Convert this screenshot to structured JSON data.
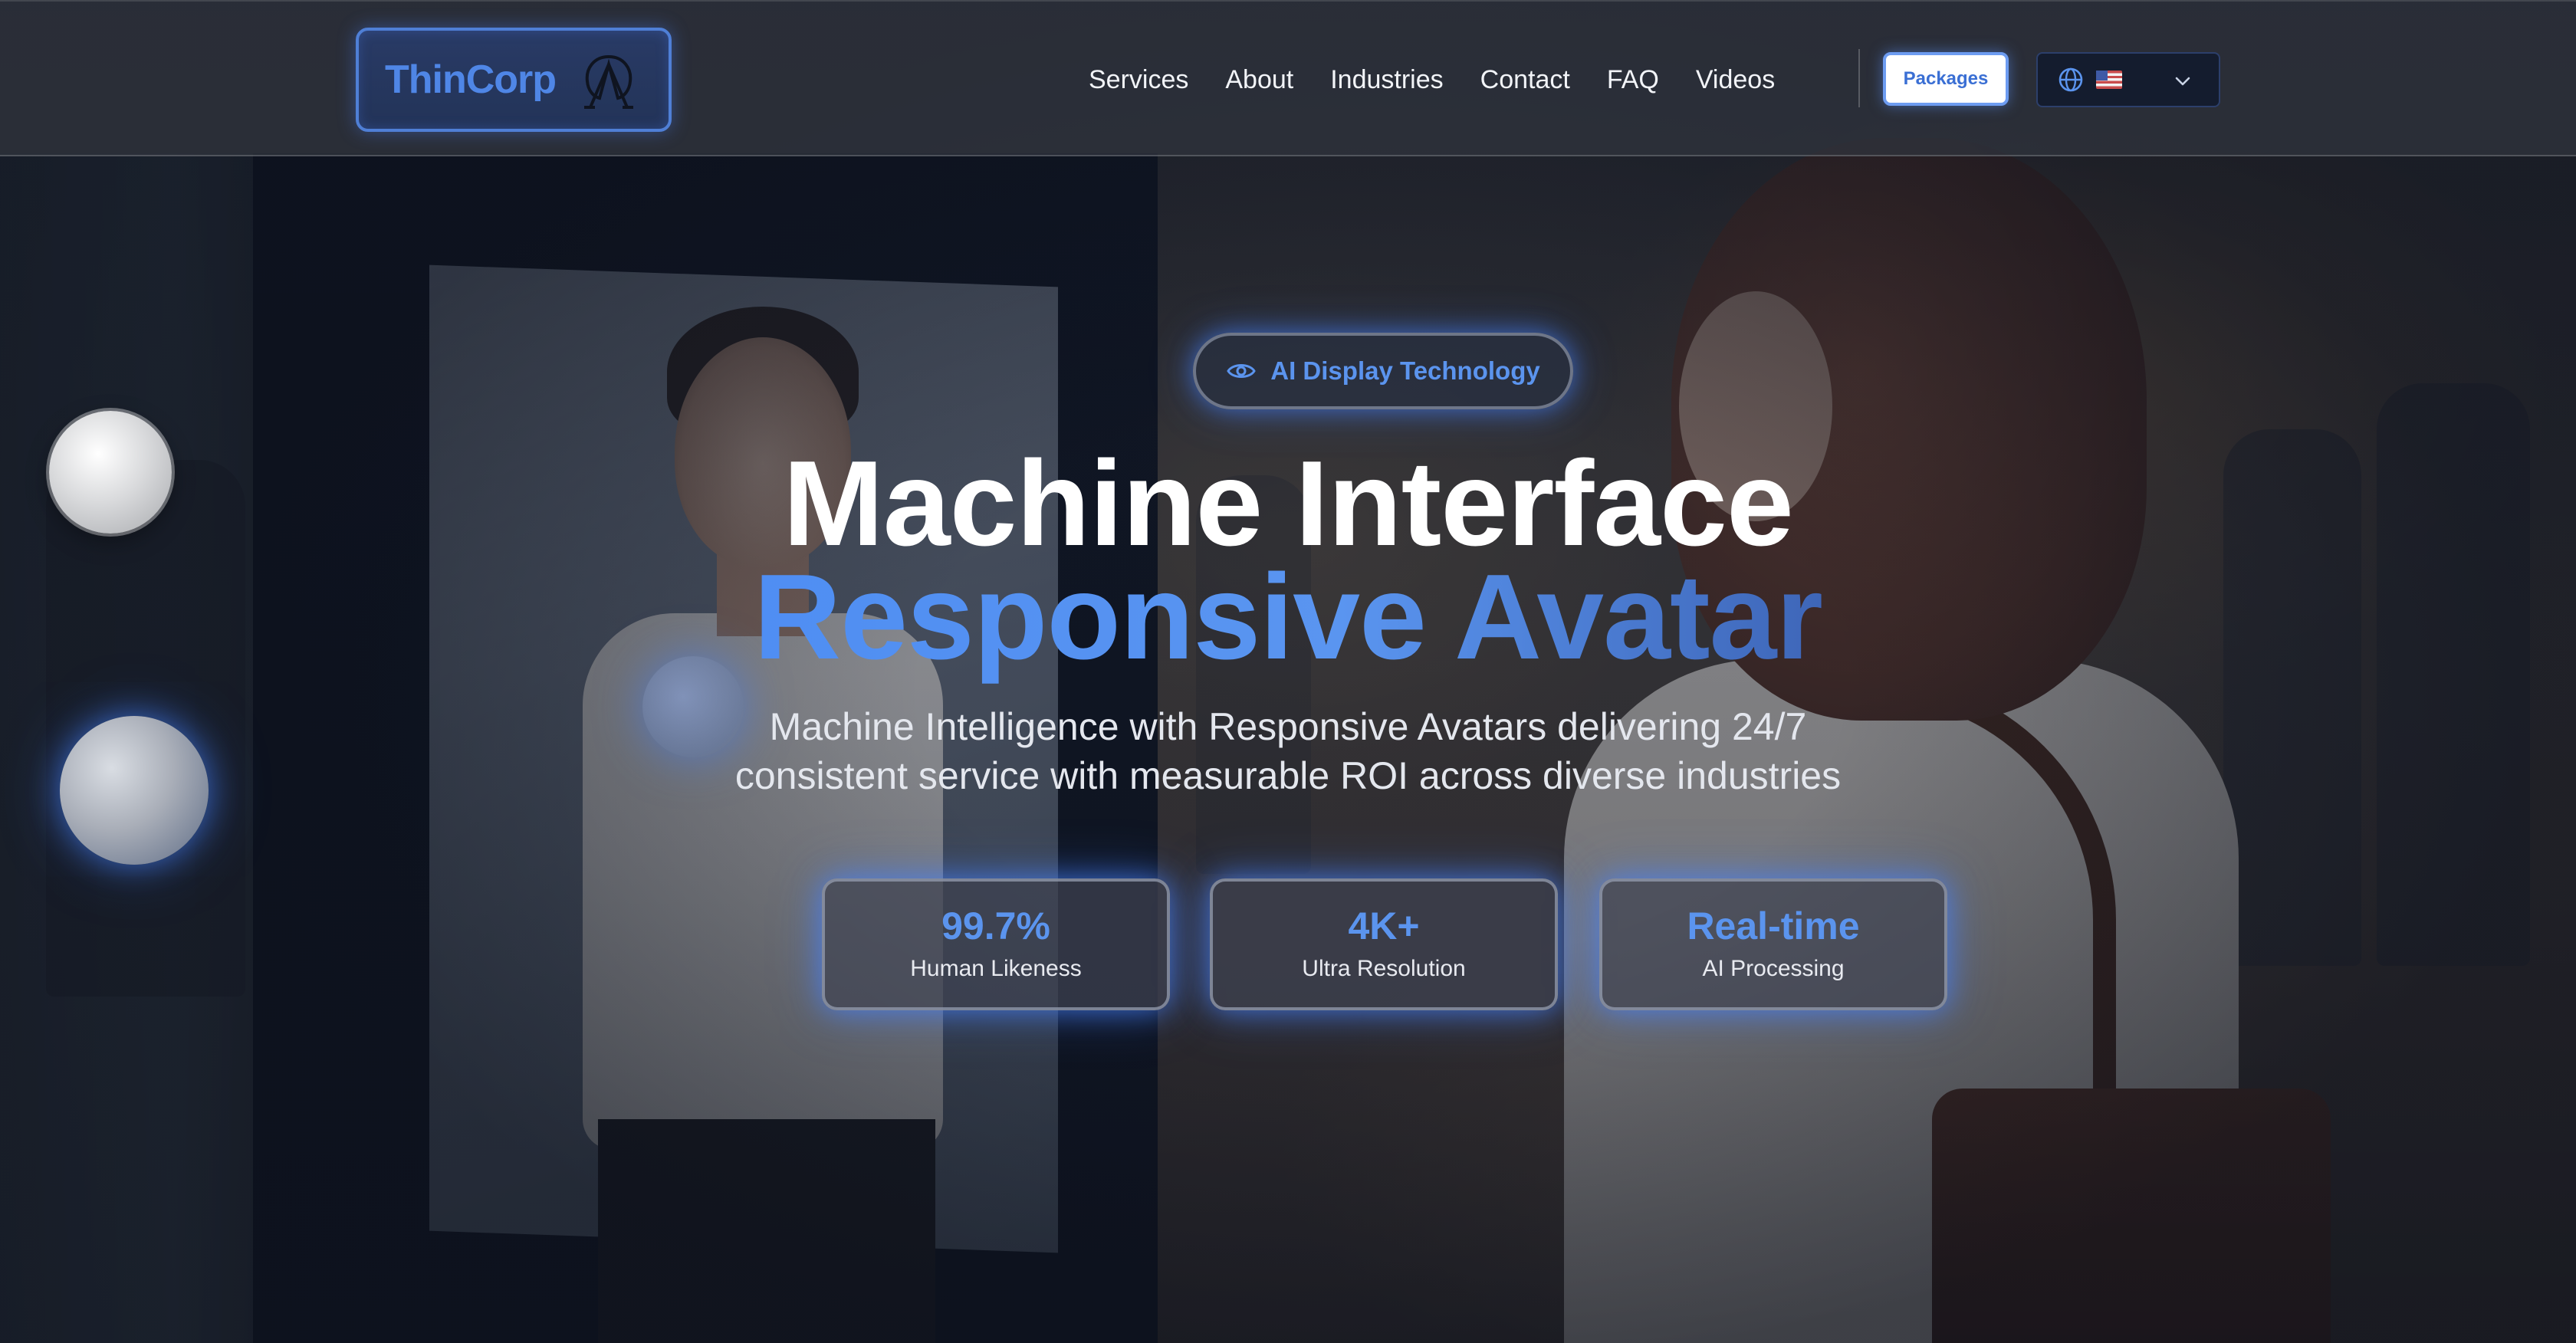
{
  "brand": {
    "name": "ThinCorp"
  },
  "nav": {
    "links": [
      "Services",
      "About",
      "Industries",
      "Contact",
      "FAQ",
      "Videos"
    ],
    "packages_label": "Packages",
    "language": {
      "icon": "globe-icon",
      "flag": "🇺🇸"
    }
  },
  "hero": {
    "badge": "AI Display Technology",
    "title_line1": "Machine Interface",
    "title_line2": "Responsive Avatar",
    "subtitle_line1": "Machine Intelligence with Responsive Avatars delivering 24/7",
    "subtitle_line2": "consistent service with measurable ROI across diverse industries"
  },
  "stats": [
    {
      "value": "99.7%",
      "label": "Human Likeness"
    },
    {
      "value": "4K+",
      "label": "Ultra Resolution"
    },
    {
      "value": "Real-time",
      "label": "AI Processing"
    }
  ],
  "colors": {
    "accent": "#5b94ee",
    "glow": "#4682ff"
  }
}
